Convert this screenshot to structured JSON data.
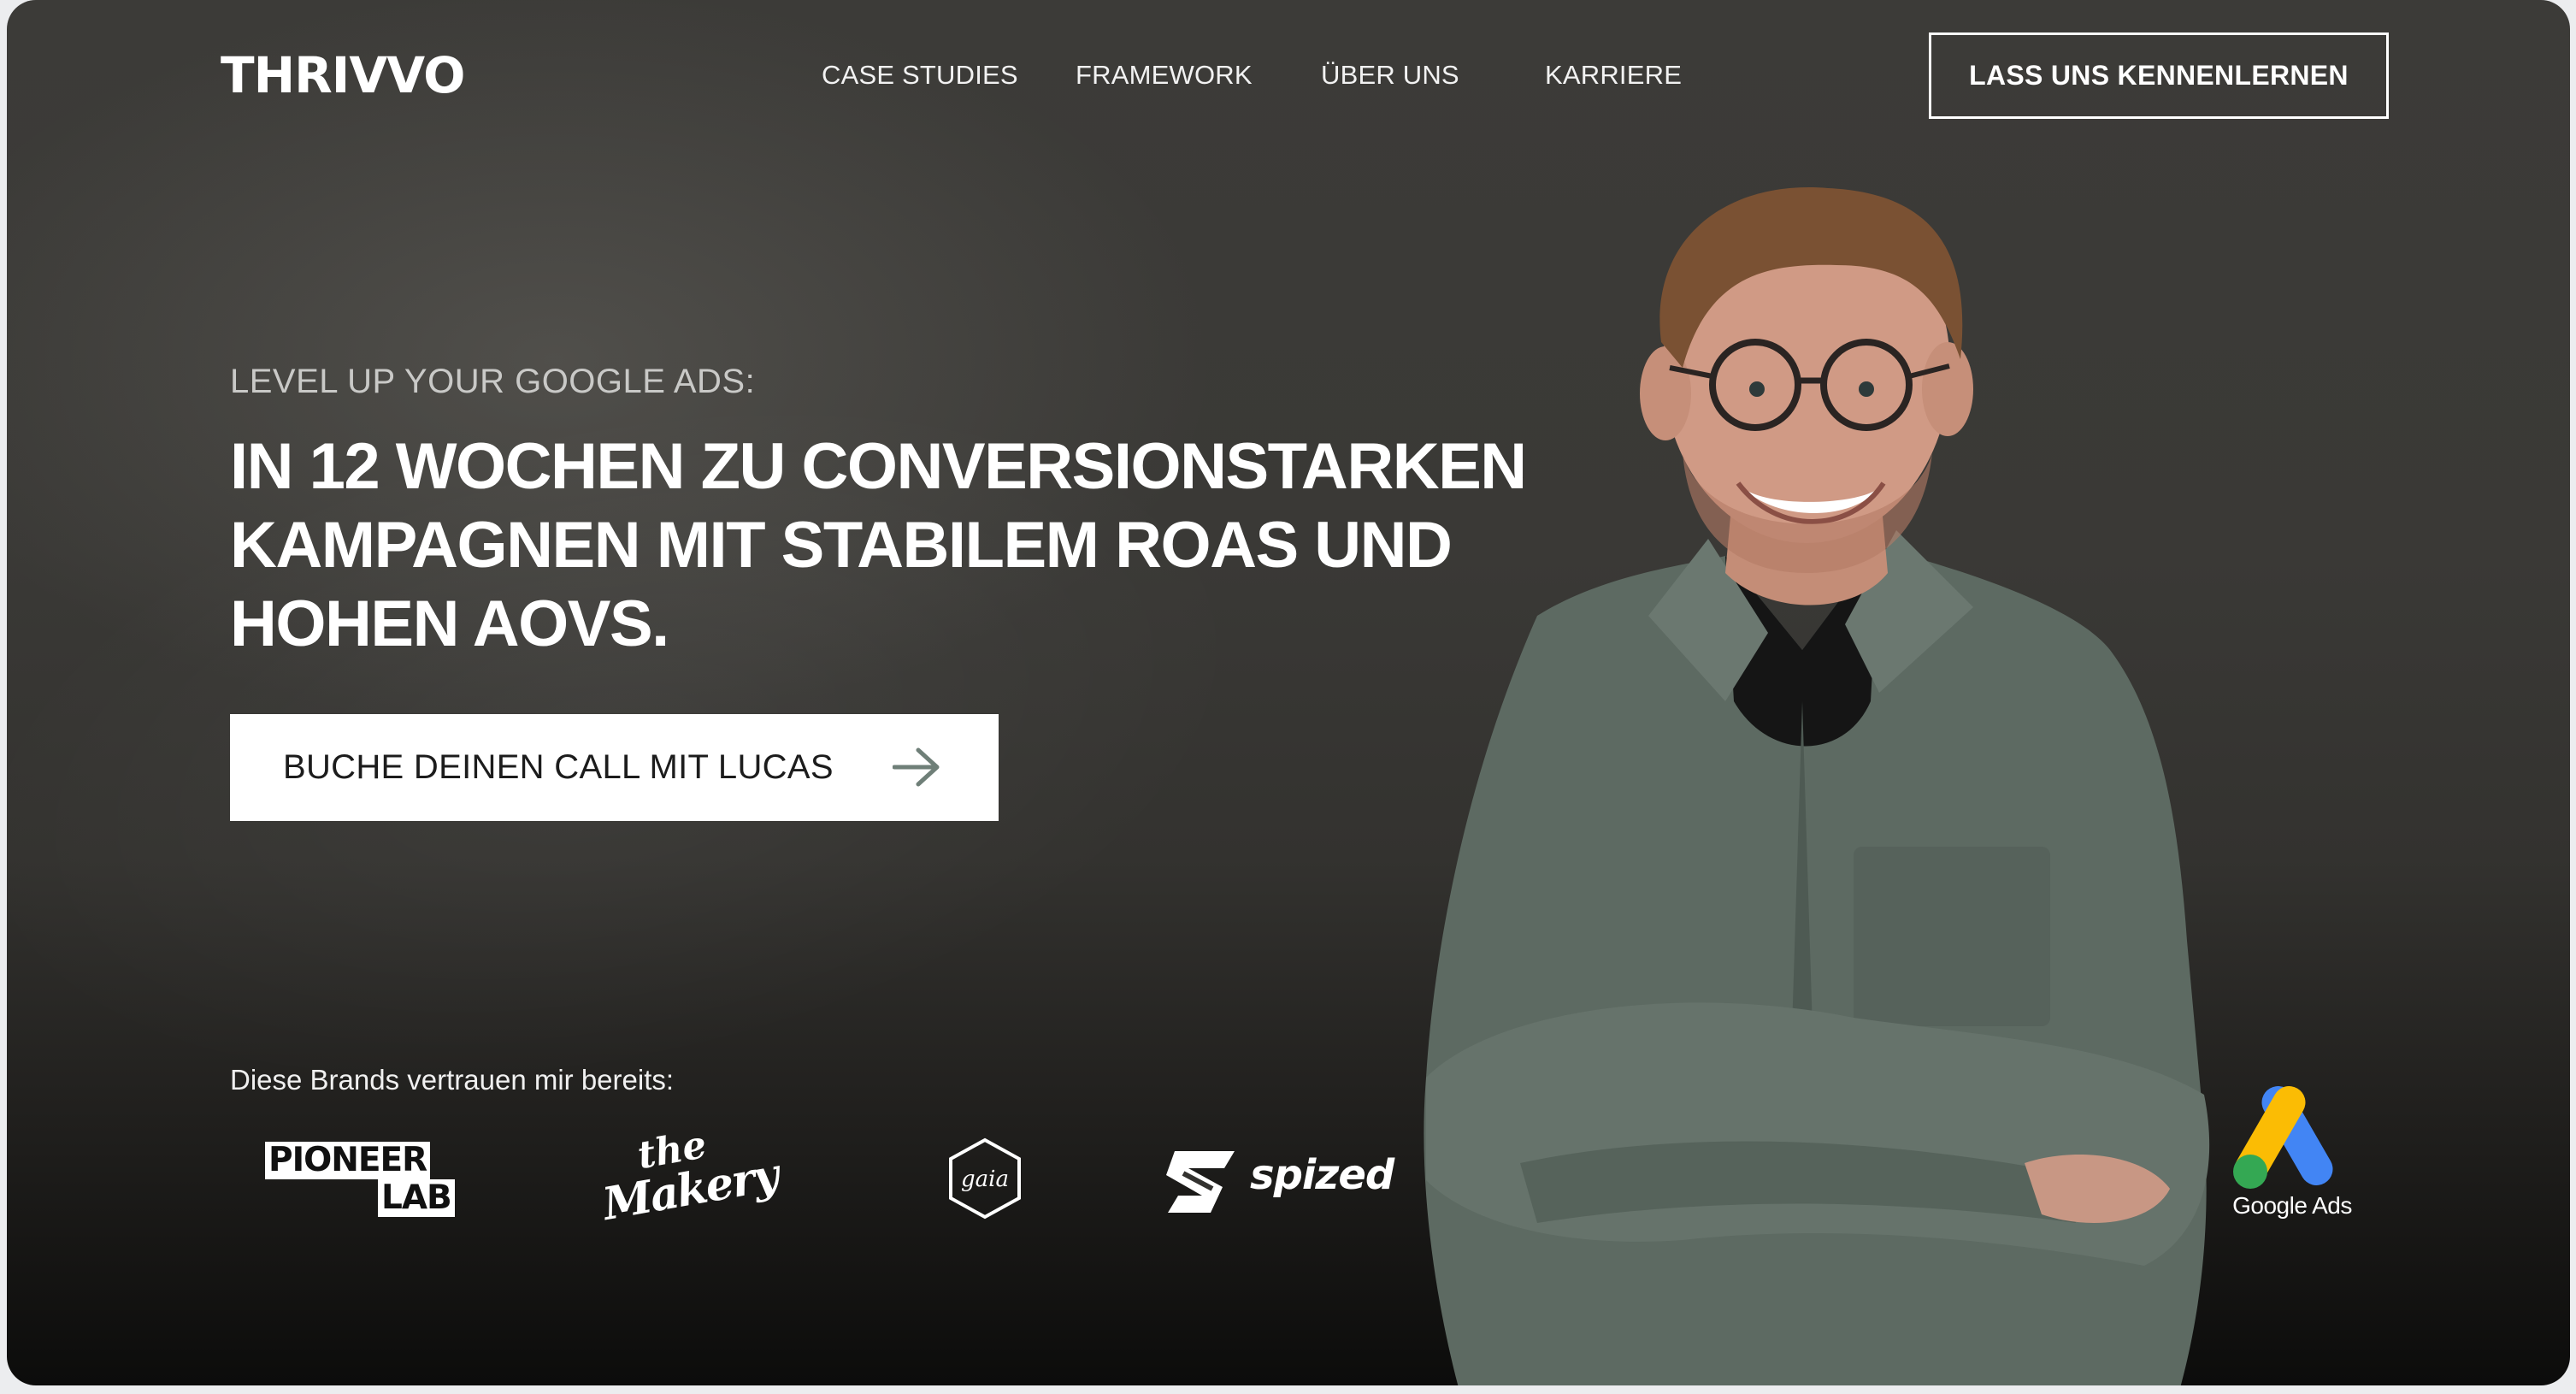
{
  "brand": {
    "logo_text": "THRIVVO"
  },
  "nav": {
    "items": [
      {
        "label": "CASE STUDIES"
      },
      {
        "label": "FRAMEWORK"
      },
      {
        "label": "ÜBER UNS"
      },
      {
        "label": "KARRIERE"
      }
    ],
    "cta_label": "LASS UNS KENNENLERNEN"
  },
  "hero": {
    "eyebrow": "LEVEL UP YOUR GOOGLE ADS:",
    "headline_lines": [
      "IN 12 WOCHEN ZU CONVERSIONSTARKEN",
      "KAMPAGNEN MIT STABILEM ROAS UND",
      "HOHEN AOVS."
    ],
    "button_label": "BUCHE DEINEN CALL MIT LUCAS",
    "button_icon": "arrow-right-icon"
  },
  "brands": {
    "label": "Diese Brands vertrauen mir bereits:",
    "logos": [
      {
        "name": "pioneer-lab-logo",
        "text_line1": "PIONEER",
        "text_line2": "LAB"
      },
      {
        "name": "the-makery-logo",
        "text_line1": "the",
        "text_line2": "Makery"
      },
      {
        "name": "gaia-logo",
        "text": "gaia"
      },
      {
        "name": "spized-logo",
        "text": "spized"
      }
    ],
    "partner_badge": {
      "name": "google-ads-logo",
      "text": "Google Ads"
    }
  },
  "colors": {
    "background": "#3a3936",
    "text": "#ffffff",
    "button_bg": "#ffffff",
    "button_text": "#1c1c1c",
    "arrow": "#6f7f78",
    "google_blue": "#4285f4",
    "google_yellow": "#fbbc04",
    "google_green": "#34a853"
  }
}
